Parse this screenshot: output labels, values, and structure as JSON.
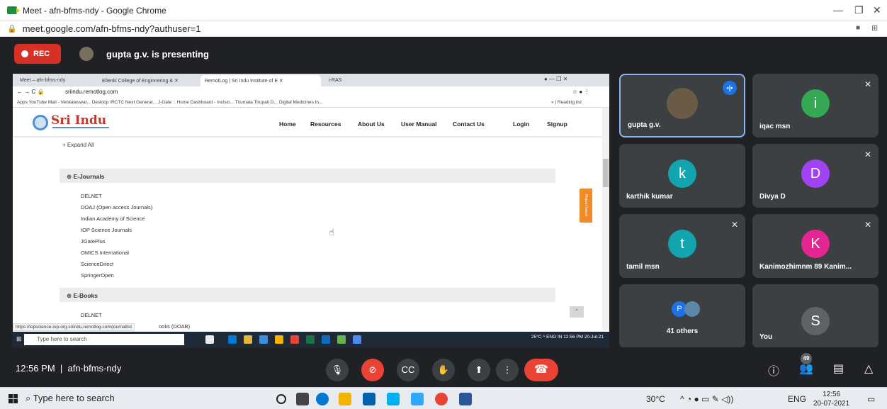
{
  "window": {
    "title": "Meet - afn-bfms-ndy - Google Chrome",
    "url": "meet.google.com/afn-bfms-ndy?authuser=1",
    "min": "—",
    "max": "❐",
    "close": "✕"
  },
  "meet": {
    "rec_label": "REC",
    "presenting": "gupta g.v. is presenting",
    "time": "12:56 PM",
    "meeting_code": "afn-bfms-ndy",
    "people_count": "49"
  },
  "shared": {
    "tabs": [
      "Meet – afn-bfms-ndy",
      "Ellenki College of Enginnering & ✕",
      "RemotLog | Sri Indu Institute of E ✕",
      "i-RAS"
    ],
    "url": "sriindu.remotlog.com",
    "bookmarks": "Apps   YouTube   Mail - Venkateswar...   Desktop   IRCTC Next Generat...   J-Gate :: Home   Dashboard - Incisio...   Tirumala Tirupati D...   Digital Medicines In...",
    "reading_list": "» | Reading list",
    "logo": "Sri Indu",
    "nav": [
      "Home",
      "Resources",
      "About Us",
      "User Manual",
      "Contact Us",
      "Login",
      "Signup"
    ],
    "expand_all": "+ Expand All",
    "section1": "⊗ E-Journals",
    "journals": [
      "DELNET",
      "DOAJ (Open access Journals)",
      "Indian Academy of Science",
      "IOP Science Journals",
      "JGatePlus",
      "OMICS International",
      "ScienceDirect",
      "SpringerOpen"
    ],
    "section2": "⊗ E-Books",
    "books": [
      "DELNET"
    ],
    "books_partial": "ooks (DOAB)",
    "report_issue": "Report Issue",
    "status_url": "https://iopscience-iop-org.sriindu.remotlog.com/journallist",
    "taskbar_search": "Type here to search",
    "tray": "25°C  ^  ENG IN   12:56 PM 20-Jul-21"
  },
  "tiles": [
    {
      "name": "gupta g.v.",
      "letter": "",
      "color": "#6b5a45"
    },
    {
      "name": "iqac msn",
      "letter": "i",
      "color": "#34a853"
    },
    {
      "name": "karthik kumar",
      "letter": "k",
      "color": "#12a4af"
    },
    {
      "name": "Divya D",
      "letter": "D",
      "color": "#a142f4"
    },
    {
      "name": "tamil msn",
      "letter": "t",
      "color": "#12a4af"
    },
    {
      "name": "Kanimozhimnm 89 Kanim...",
      "letter": "K",
      "color": "#e52592"
    },
    {
      "name": "41 others",
      "letter": "P",
      "color": "#1a73e8"
    },
    {
      "name": "You",
      "letter": "S",
      "color": "#5f6368"
    }
  ],
  "taskbar": {
    "search": "Type here to search",
    "weather": "30°C",
    "lang": "ENG",
    "time": "12:56",
    "date": "20-07-2021"
  },
  "colors": {
    "meet_bg": "#202124",
    "tile_bg": "#3c4043",
    "rec_red": "#d93025",
    "hangup": "#ea4335"
  }
}
